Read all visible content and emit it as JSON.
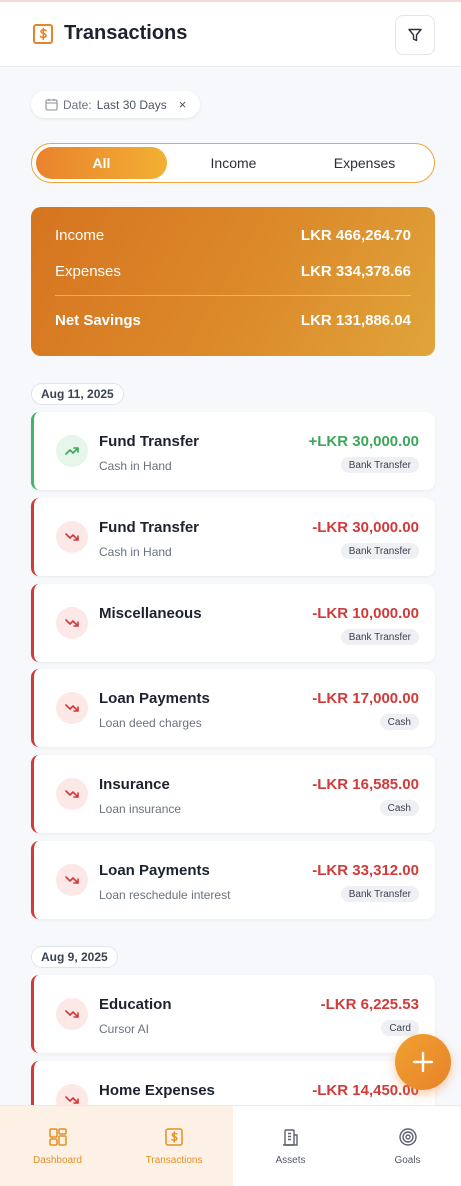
{
  "header": {
    "title": "Transactions"
  },
  "filter_chip": {
    "label": "Date:",
    "value": "Last 30 Days",
    "clear": "×"
  },
  "segments": [
    "All",
    "Income",
    "Expenses"
  ],
  "summary": {
    "income_label": "Income",
    "income_value": "LKR 466,264.70",
    "expenses_label": "Expenses",
    "expenses_value": "LKR 334,378.66",
    "net_label": "Net Savings",
    "net_value": "LKR 131,886.04"
  },
  "groups": [
    {
      "date": "Aug 11, 2025",
      "transactions": [
        {
          "name": "Fund Transfer",
          "sub": "Cash in Hand",
          "amount": "+LKR 30,000.00",
          "tag": "Bank Transfer",
          "direction": "in"
        },
        {
          "name": "Fund Transfer",
          "sub": "Cash in Hand",
          "amount": "-LKR 30,000.00",
          "tag": "Bank Transfer",
          "direction": "out"
        },
        {
          "name": "Miscellaneous",
          "sub": "",
          "amount": "-LKR 10,000.00",
          "tag": "Bank Transfer",
          "direction": "out"
        },
        {
          "name": "Loan Payments",
          "sub": "Loan deed charges",
          "amount": "-LKR 17,000.00",
          "tag": "Cash",
          "direction": "out"
        },
        {
          "name": "Insurance",
          "sub": "Loan insurance",
          "amount": "-LKR 16,585.00",
          "tag": "Cash",
          "direction": "out"
        },
        {
          "name": "Loan Payments",
          "sub": "Loan reschedule interest",
          "amount": "-LKR 33,312.00",
          "tag": "Bank Transfer",
          "direction": "out"
        }
      ]
    },
    {
      "date": "Aug 9, 2025",
      "transactions": [
        {
          "name": "Education",
          "sub": "Cursor AI",
          "amount": "-LKR 6,225.53",
          "tag": "Card",
          "direction": "out"
        },
        {
          "name": "Home Expenses",
          "sub": "",
          "amount": "-LKR 14,450.00",
          "tag": "",
          "direction": "out"
        }
      ]
    }
  ],
  "bottom_nav": [
    {
      "label": "Dashboard",
      "icon": "dashboard-icon"
    },
    {
      "label": "Transactions",
      "icon": "dollar-receipt-icon"
    },
    {
      "label": "Assets",
      "icon": "building-icon"
    },
    {
      "label": "Goals",
      "icon": "target-icon"
    }
  ],
  "colors": {
    "accent": "#e8832a",
    "income": "#3aa75a",
    "expense": "#d23a3a"
  }
}
